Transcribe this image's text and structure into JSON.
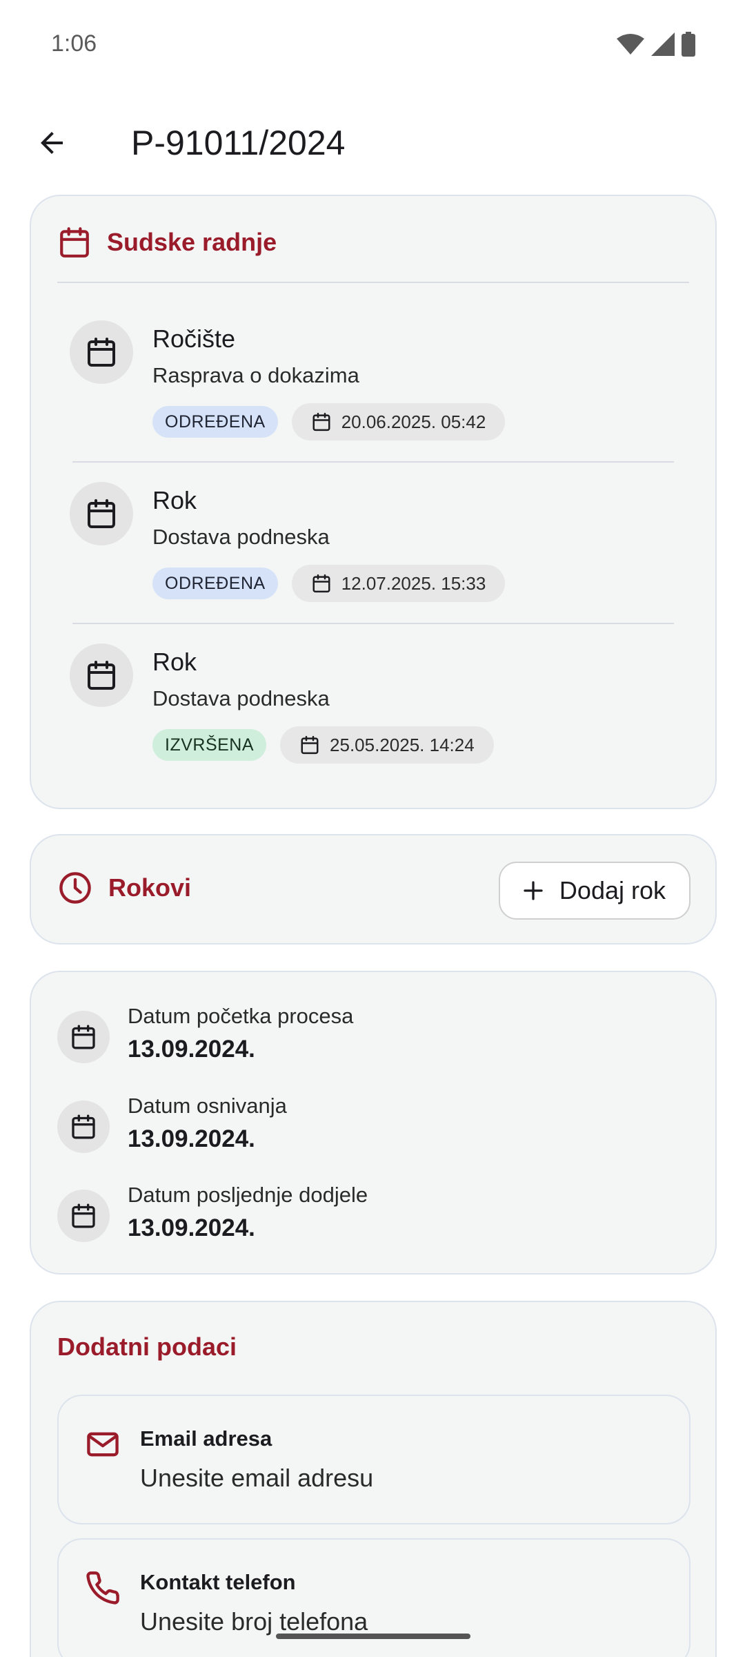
{
  "status_bar": {
    "time": "1:06"
  },
  "app_bar": {
    "title": "P-91011/2024"
  },
  "court_actions": {
    "title": "Sudske radnje",
    "items": [
      {
        "title": "Ročište",
        "description": "Rasprava o dokazima",
        "status": "ODREĐENA",
        "datetime": "20.06.2025. 05:42"
      },
      {
        "title": "Rok",
        "description": "Dostava podneska",
        "status": "ODREĐENA",
        "datetime": "12.07.2025. 15:33"
      },
      {
        "title": "Rok",
        "description": "Dostava podneska",
        "status": "IZVRŠENA",
        "datetime": "25.05.2025. 14:24"
      }
    ]
  },
  "deadlines": {
    "title": "Rokovi",
    "add_button": "Dodaj rok"
  },
  "dates": [
    {
      "label": "Datum početka procesa",
      "value": "13.09.2024."
    },
    {
      "label": "Datum osnivanja",
      "value": "13.09.2024."
    },
    {
      "label": "Datum posljednje dodjele",
      "value": "13.09.2024."
    }
  ],
  "extra": {
    "title": "Dodatni podaci",
    "email": {
      "label": "Email adresa",
      "placeholder": "Unesite email adresu"
    },
    "phone": {
      "label": "Kontakt telefon",
      "placeholder": "Unesite broj telefona"
    }
  },
  "colors": {
    "accent": "#9a1b29",
    "card_bg": "#f4f6f6",
    "chip_assigned": "#d6e2f7",
    "chip_done": "#cfeedb"
  }
}
